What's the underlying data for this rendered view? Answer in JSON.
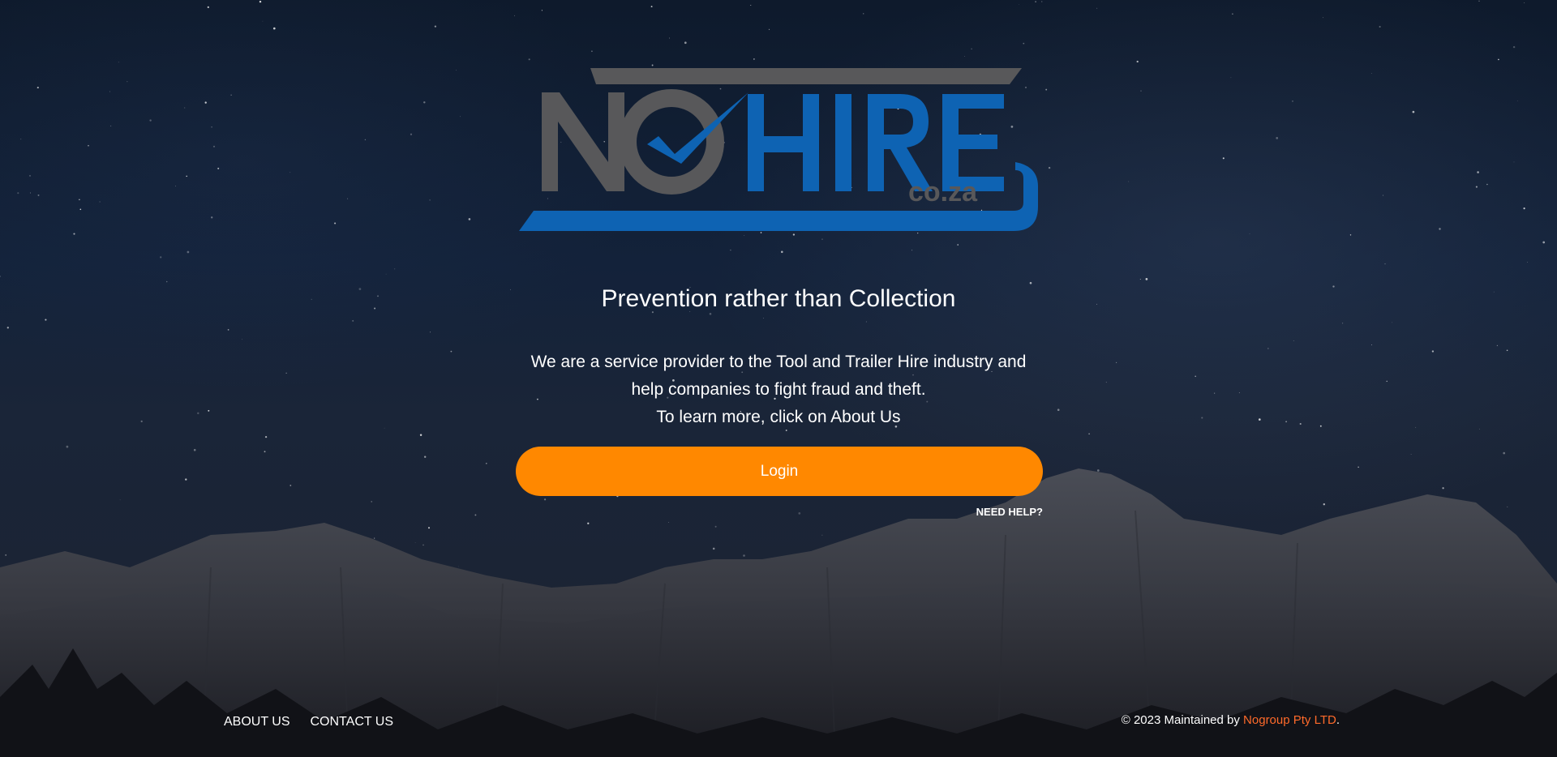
{
  "logo": {
    "text_no": "NO",
    "text_hire": "HIRE",
    "text_domain": "co.za",
    "colors": {
      "grey": "#58585a",
      "blue": "#0e63b3"
    }
  },
  "hero": {
    "tagline": "Prevention rather than Collection",
    "description_lines": [
      "We are a service provider to the Tool and Trailer Hire industry and",
      "help companies to fight fraud and theft.",
      "To learn more, click on About Us"
    ]
  },
  "login": {
    "button_label": "Login",
    "need_help_label": "NEED HELP?"
  },
  "footer": {
    "links": [
      "ABOUT US",
      "CONTACT US"
    ],
    "copyright_prefix": "© 2023 Maintained by ",
    "company_link": "Nogroup Pty LTD",
    "copyright_suffix": "."
  },
  "colors": {
    "accent": "#ff8800",
    "company_link": "#ff6a2a",
    "text": "#ffffff"
  }
}
